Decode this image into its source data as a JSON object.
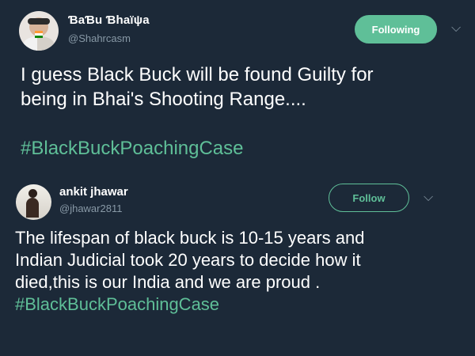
{
  "tweets": [
    {
      "display_name": "ƁaƁu Ɓhaïψa",
      "handle": "@Shahrcasm",
      "button_label": "Following",
      "text_lines": [
        "I guess Black Buck will be found Guilty for",
        "being in Bhai's Shooting Range...."
      ],
      "hashtag": "#BlackBuckPoachingCase"
    },
    {
      "display_name": "ankit jhawar",
      "handle": "@jhawar2811",
      "button_label": "Follow",
      "text_lines": [
        "The lifespan of black buck is 10-15 years and",
        "Indian Judicial took 20 years to decide how it",
        "died,this is our India and we are proud ."
      ],
      "hashtag": "#BlackBuckPoachingCase"
    }
  ],
  "icons": {
    "chevron": "chevron-down-icon"
  },
  "colors": {
    "background": "#1c2938",
    "accent": "#5fbf98",
    "secondary_text": "#8899a6"
  }
}
